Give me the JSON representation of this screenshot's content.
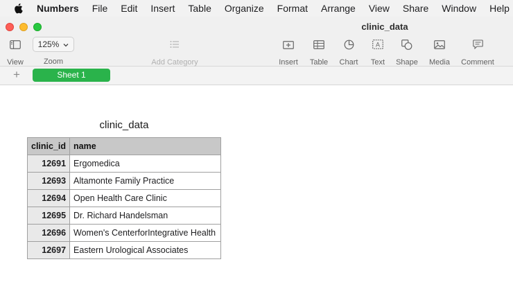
{
  "menubar": {
    "items": [
      "Numbers",
      "File",
      "Edit",
      "Insert",
      "Table",
      "Organize",
      "Format",
      "Arrange",
      "View",
      "Share",
      "Window",
      "Help"
    ]
  },
  "window": {
    "title": "clinic_data"
  },
  "toolbar": {
    "view_label": "View",
    "zoom_label": "Zoom",
    "zoom_value": "125%",
    "add_category_label": "Add Category",
    "insert_label": "Insert",
    "table_label": "Table",
    "chart_label": "Chart",
    "text_label": "Text",
    "shape_label": "Shape",
    "media_label": "Media",
    "comment_label": "Comment"
  },
  "sheets": {
    "add_symbol": "+",
    "tabs": [
      {
        "label": "Sheet 1",
        "active": true
      }
    ]
  },
  "table": {
    "title": "clinic_data",
    "columns": [
      "clinic_id",
      "name"
    ],
    "rows": [
      {
        "clinic_id": "12691",
        "name": "Ergomedica"
      },
      {
        "clinic_id": "12693",
        "name": "Altamonte Family Practice"
      },
      {
        "clinic_id": "12694",
        "name": "Open Health Care Clinic"
      },
      {
        "clinic_id": "12695",
        "name": "Dr. Richard Handelsman"
      },
      {
        "clinic_id": "12696",
        "name": "Women's CenterforIntegrative Health"
      },
      {
        "clinic_id": "12697",
        "name": "Eastern Urological Associates"
      }
    ]
  },
  "colors": {
    "sheet_tab_active": "#2ab34b",
    "close": "#fe5f57",
    "minimize": "#febc2e",
    "zoom": "#28c840"
  }
}
